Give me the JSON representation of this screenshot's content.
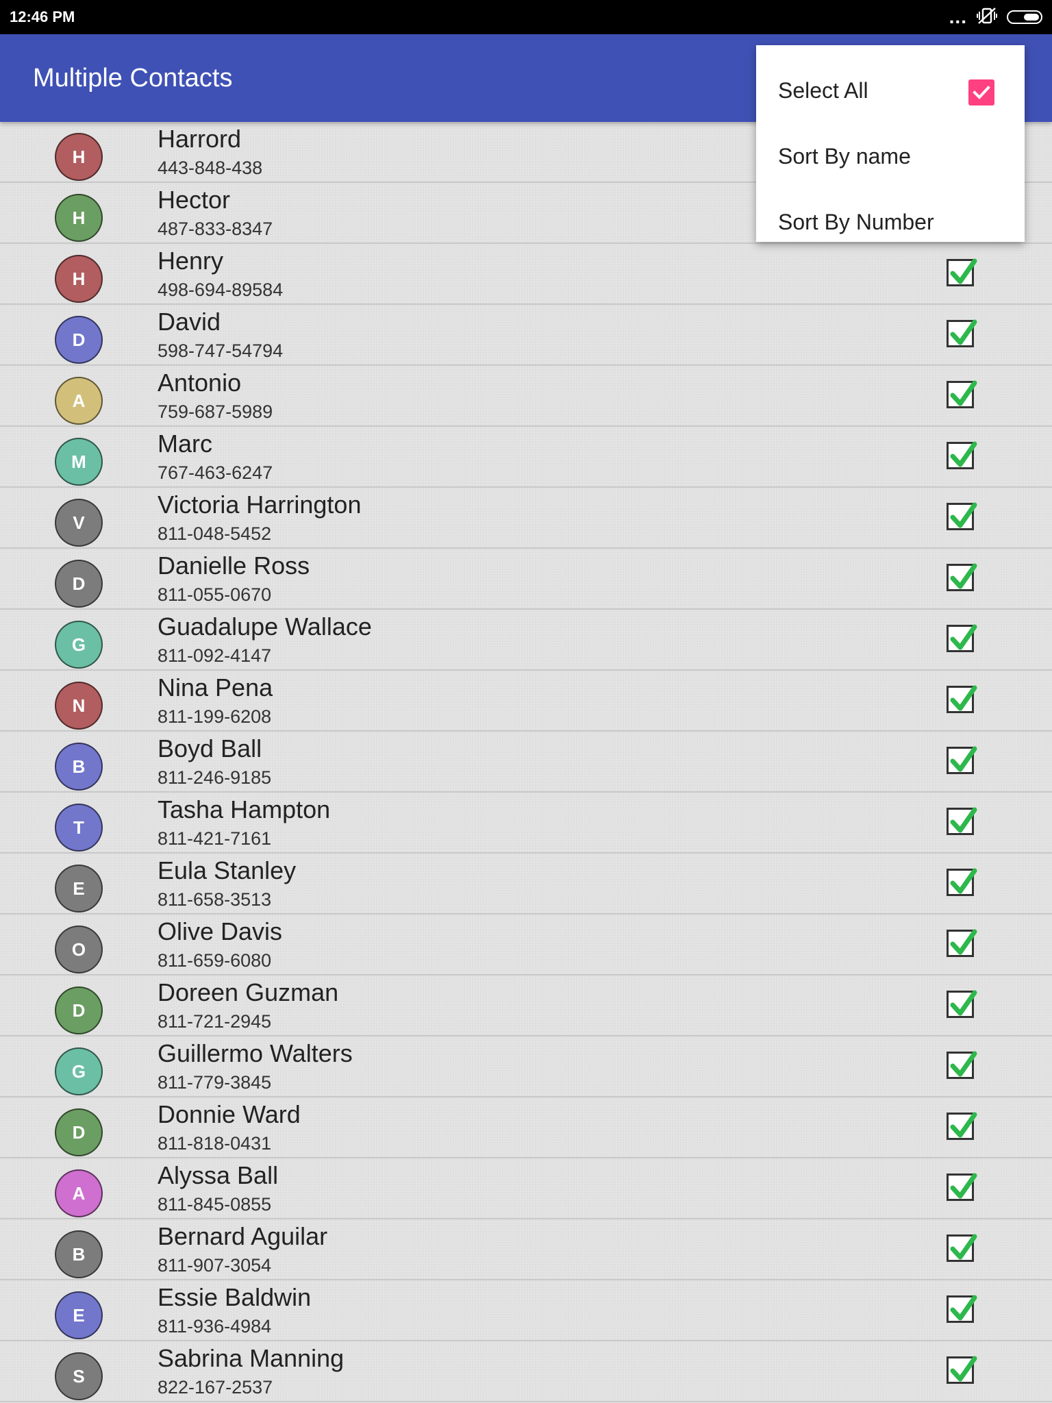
{
  "status_bar": {
    "time": "12:46 PM",
    "overflow": "..."
  },
  "app_bar": {
    "title": "Multiple Contacts"
  },
  "menu": {
    "items": [
      {
        "label": "Select All",
        "checked": true
      },
      {
        "label": "Sort By name"
      },
      {
        "label": "Sort By Number"
      }
    ],
    "check_color": "#ff4081"
  },
  "colors": {
    "app_bar": "#3f51b5",
    "check_green": "#2db84b"
  },
  "contacts": [
    {
      "initial": "H",
      "name": "Harrord",
      "phone": "443-848-438",
      "avatar_color": "#b25d60",
      "checked": true
    },
    {
      "initial": "H",
      "name": "Hector",
      "phone": "487-833-8347",
      "avatar_color": "#6b9e62",
      "checked": true
    },
    {
      "initial": "H",
      "name": "Henry",
      "phone": "498-694-89584",
      "avatar_color": "#b25d60",
      "checked": true
    },
    {
      "initial": "D",
      "name": "David",
      "phone": "598-747-54794",
      "avatar_color": "#7277cc",
      "checked": true
    },
    {
      "initial": "A",
      "name": "Antonio",
      "phone": "759-687-5989",
      "avatar_color": "#d2c07a",
      "checked": true
    },
    {
      "initial": "M",
      "name": "Marc",
      "phone": "767-463-6247",
      "avatar_color": "#6bbfa5",
      "checked": true
    },
    {
      "initial": "V",
      "name": "Victoria Harrington",
      "phone": "811-048-5452",
      "avatar_color": "#7c7c7c",
      "checked": true
    },
    {
      "initial": "D",
      "name": "Danielle Ross",
      "phone": "811-055-0670",
      "avatar_color": "#7c7c7c",
      "checked": true
    },
    {
      "initial": "G",
      "name": "Guadalupe Wallace",
      "phone": "811-092-4147",
      "avatar_color": "#6bbfa5",
      "checked": true
    },
    {
      "initial": "N",
      "name": "Nina Pena",
      "phone": "811-199-6208",
      "avatar_color": "#b25d60",
      "checked": true
    },
    {
      "initial": "B",
      "name": "Boyd Ball",
      "phone": "811-246-9185",
      "avatar_color": "#7277cc",
      "checked": true
    },
    {
      "initial": "T",
      "name": "Tasha Hampton",
      "phone": "811-421-7161",
      "avatar_color": "#7277cc",
      "checked": true
    },
    {
      "initial": "E",
      "name": "Eula Stanley",
      "phone": "811-658-3513",
      "avatar_color": "#7c7c7c",
      "checked": true
    },
    {
      "initial": "O",
      "name": "Olive Davis",
      "phone": "811-659-6080",
      "avatar_color": "#7c7c7c",
      "checked": true
    },
    {
      "initial": "D",
      "name": "Doreen Guzman",
      "phone": "811-721-2945",
      "avatar_color": "#6b9e62",
      "checked": true
    },
    {
      "initial": "G",
      "name": "Guillermo Walters",
      "phone": "811-779-3845",
      "avatar_color": "#6bbfa5",
      "checked": true
    },
    {
      "initial": "D",
      "name": "Donnie Ward",
      "phone": "811-818-0431",
      "avatar_color": "#6b9e62",
      "checked": true
    },
    {
      "initial": "A",
      "name": "Alyssa Ball",
      "phone": "811-845-0855",
      "avatar_color": "#cf6fcf",
      "checked": true
    },
    {
      "initial": "B",
      "name": "Bernard Aguilar",
      "phone": "811-907-3054",
      "avatar_color": "#7c7c7c",
      "checked": true
    },
    {
      "initial": "E",
      "name": "Essie Baldwin",
      "phone": "811-936-4984",
      "avatar_color": "#7277cc",
      "checked": true
    },
    {
      "initial": "S",
      "name": "Sabrina Manning",
      "phone": "822-167-2537",
      "avatar_color": "#7c7c7c",
      "checked": true
    }
  ]
}
